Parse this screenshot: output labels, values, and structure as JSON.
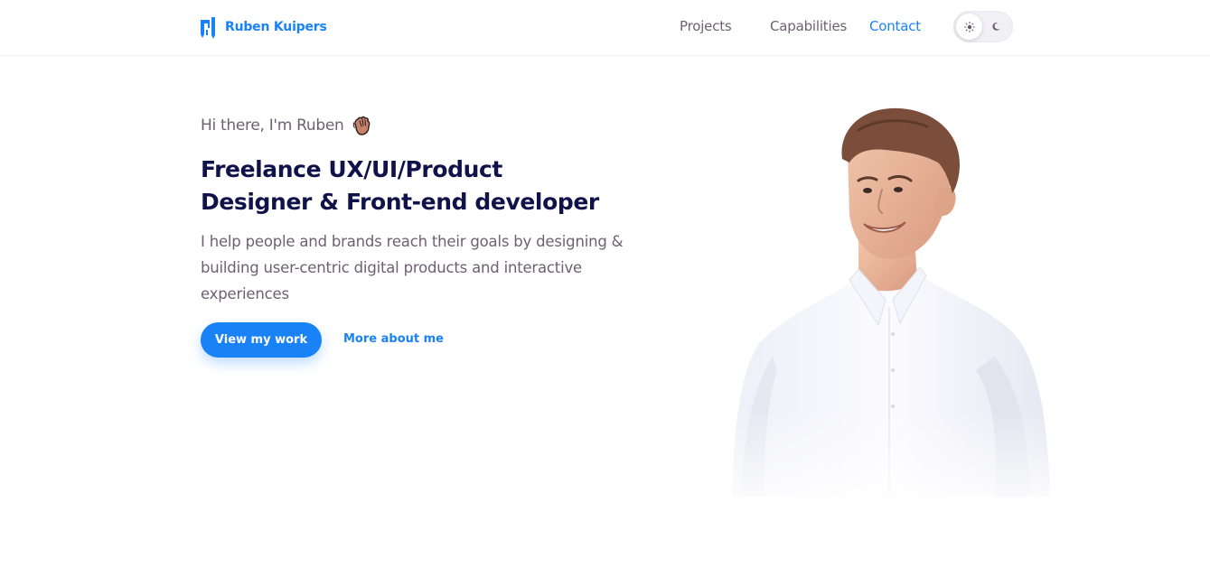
{
  "header": {
    "brand_name": "Ruben Kuipers",
    "nav": {
      "projects": "Projects",
      "capabilities": "Capabilities",
      "contact": "Contact"
    },
    "theme_toggle": {
      "icons": [
        "sun-icon",
        "moon-icon"
      ],
      "selected": "light"
    }
  },
  "hero": {
    "greeting": "Hi there, I'm Ruben",
    "greeting_icon": "waving-hand-icon",
    "headline_line1": "Freelance UX/UI/Product",
    "headline_line2": "Designer & Front-end developer",
    "intro_line1": "I help people and brands reach their goals by designing &",
    "intro_line2": "building user-centric digital products and interactive",
    "intro_line3": "experiences",
    "primary_button": "View my work",
    "secondary_link": "More about me"
  },
  "colors": {
    "accent": "#1a82f7",
    "heading": "#10134a",
    "body_text": "#6f5f72"
  }
}
